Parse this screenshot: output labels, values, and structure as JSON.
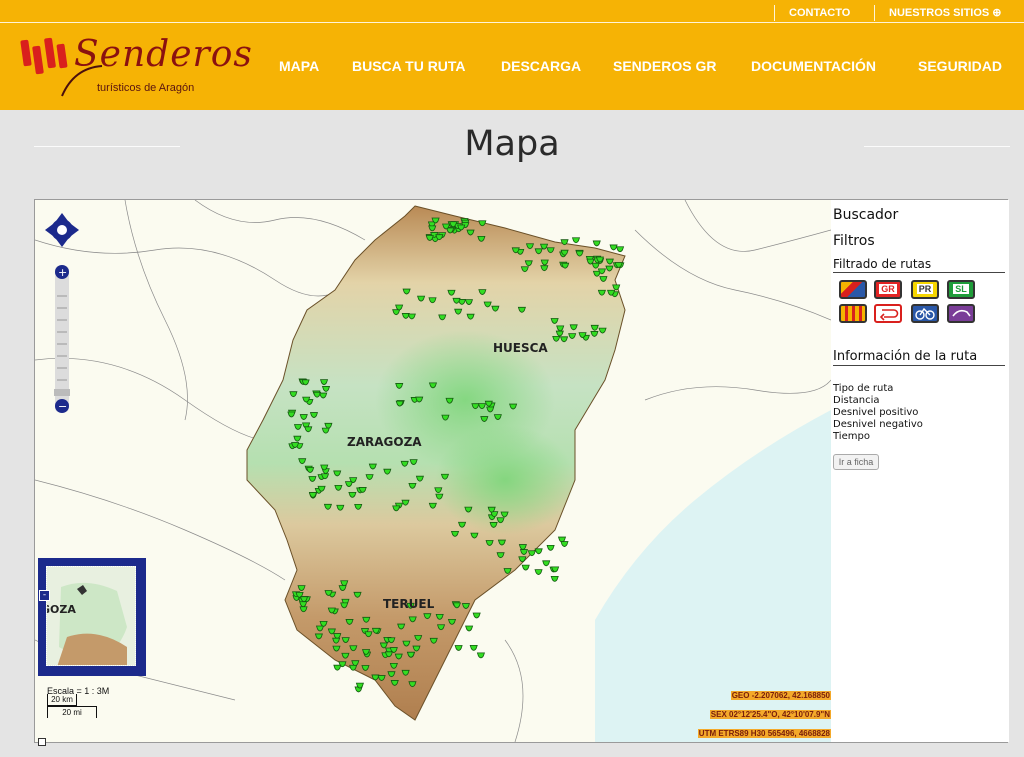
{
  "header": {
    "top_links": [
      "CONTACTO",
      "NUESTROS SITIOS ⊕"
    ],
    "logo_name": "Senderos",
    "logo_subtitle": "turísticos de Aragón",
    "nav": [
      "MAPA",
      "BUSCA TU RUTA",
      "DESCARGA",
      "SENDEROS GR",
      "DOCUMENTACIÓN",
      "SEGURIDAD"
    ]
  },
  "page_title": "Mapa",
  "map": {
    "region_labels": [
      "HUESCA",
      "ZARAGOZA",
      "TERUEL"
    ],
    "overview_label": "GOZA",
    "scale_label": "Escala = 1 : 3M",
    "scale_km": "20 km",
    "scale_mi": "20 mi",
    "coords": {
      "geo": "GEO -2.207062, 42.168850",
      "sex": "SEX 02°12'25.4\"O, 42°10'07.9\"N",
      "utm": "UTM ETRS89 H30 565496, 4668828"
    },
    "marker_color": "#33dd22"
  },
  "panel": {
    "buscador": "Buscador",
    "filtros": "Filtros",
    "filtrado": "Filtrado de rutas",
    "filter_buttons": [
      "",
      "GR",
      "PR",
      "SL",
      "",
      "",
      "",
      ""
    ],
    "informacion": "Información de la ruta",
    "fields": [
      "Tipo de ruta",
      "Distancia",
      "Desnivel positivo",
      "Desnivel negativo",
      "Tiempo"
    ],
    "ficha_button": "Ir a ficha"
  },
  "colors": {
    "header_bg": "#f6b305",
    "logo_red": "#d9201d",
    "sea": "#ddf3f3",
    "land": "#fbfbf0"
  }
}
